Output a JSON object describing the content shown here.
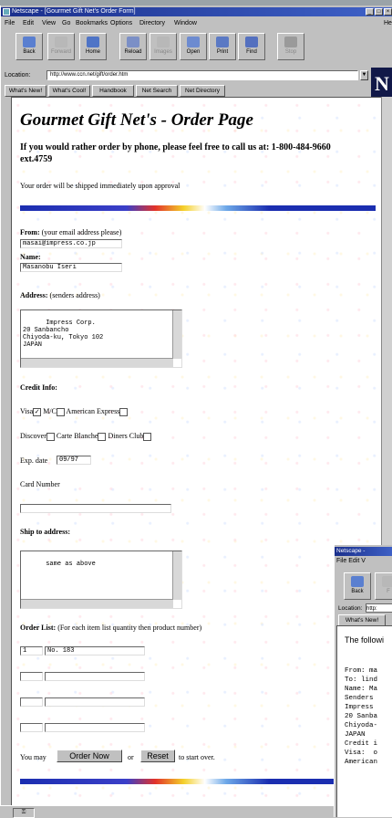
{
  "window": {
    "title": "Netscape - [Gourmet Gift Net's Order Form]",
    "controls": [
      "_",
      "□",
      "×"
    ]
  },
  "menu": [
    "File",
    "Edit",
    "View",
    "Go",
    "Bookmarks",
    "Options",
    "Directory",
    "Window",
    "He"
  ],
  "toolbar": [
    {
      "label": "Back",
      "icon": "back-arrow-icon",
      "enabled": true
    },
    {
      "label": "Forward",
      "icon": "forward-arrow-icon",
      "enabled": false
    },
    {
      "label": "Home",
      "icon": "home-icon",
      "enabled": true
    },
    {
      "label": "Reload",
      "icon": "reload-icon",
      "enabled": true
    },
    {
      "label": "Images",
      "icon": "images-icon",
      "enabled": false
    },
    {
      "label": "Open",
      "icon": "open-icon",
      "enabled": true
    },
    {
      "label": "Print",
      "icon": "print-icon",
      "enabled": true
    },
    {
      "label": "Find",
      "icon": "find-icon",
      "enabled": true
    },
    {
      "label": "Stop",
      "icon": "stop-icon",
      "enabled": false
    }
  ],
  "location": {
    "label": "Location:",
    "url": "http://www.ccn.net/gift/order.htm"
  },
  "logo": "N",
  "directory_buttons": [
    "What's New!",
    "What's Cool!",
    "Handbook",
    "Net Search",
    "Net Directory"
  ],
  "page": {
    "title": "Gourmet Gift Net's - Order Page",
    "phone_text": "If you would rather order by phone, please feel free to call us at: 1-800-484-9660 ext.4759",
    "shipped_note": "Your order will be shipped immediately upon approval",
    "from_label": "From:",
    "from_hint": "(your email address please)",
    "from_value": "masai@impress.co.jp",
    "name_label": "Name:",
    "name_value": "Masanobu Iseri",
    "address_label": "Address:",
    "address_hint": "(senders address)",
    "address_value": "Impress Corp.\n20 Sanbancho\nChiyoda-ku, Tokyo 102\nJAPAN",
    "credit_label": "Credit Info:",
    "cards_row1": [
      {
        "label": "Visa",
        "checked": true
      },
      {
        "label": "M/C",
        "checked": false
      },
      {
        "label": "American Express",
        "checked": false
      }
    ],
    "cards_row2": [
      {
        "label": "Discover",
        "checked": false
      },
      {
        "label": "Carte Blanche",
        "checked": false
      },
      {
        "label": "Diners Club",
        "checked": false
      }
    ],
    "exp_label": "Exp. date",
    "exp_value": "09/97",
    "card_number_label": "Card Number",
    "card_number_value": "",
    "ship_label": "Ship to address:",
    "ship_value": "same as above",
    "order_label": "Order List:",
    "order_hint": "(For each item list quantity then product number)",
    "order_rows": [
      {
        "qty": "1",
        "product": "No. 183"
      },
      {
        "qty": "",
        "product": ""
      },
      {
        "qty": "",
        "product": ""
      },
      {
        "qty": "",
        "product": ""
      }
    ],
    "footer_pre": "You may",
    "order_button": "Order Now",
    "footer_or": "or",
    "reset_button": "Reset",
    "footer_post": "to start over."
  },
  "statusbar": {
    "key_icon": "key-icon"
  },
  "second_window": {
    "title": "Netscape -",
    "menu": "File  Edit  V",
    "toolbar_labels": [
      "Back",
      "F"
    ],
    "location_label": "Location:",
    "location_value": "http:",
    "whats_new": "What's New!",
    "message": "The followi",
    "mono_lines": "From: ma\nTo: lind\nName: Ma\nSenders \nImpress \n20 Sanba\nChiyoda-\nJAPAN\nCredit i\nVisa:  o\nAmerican"
  }
}
